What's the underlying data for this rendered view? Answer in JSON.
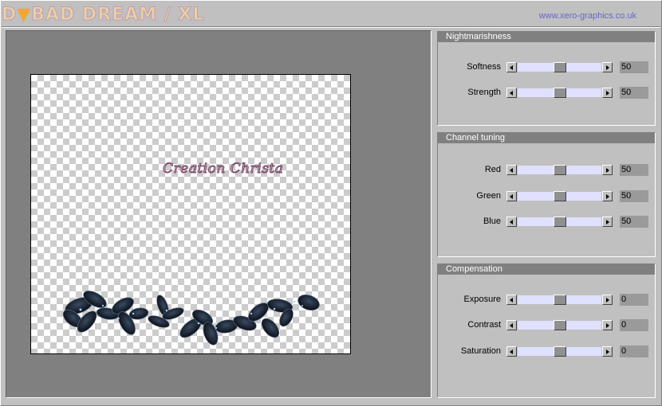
{
  "title": {
    "logo_prefix": "D",
    "logo_triangle": "▼",
    "logo_text": "BAD DREAM / XL",
    "url": "www.xero-graphics.co.uk"
  },
  "preview": {
    "signature_text": "Creation Christa"
  },
  "panels": [
    {
      "header": "Nightmarishness",
      "rows": [
        {
          "label": "Softness",
          "value": "50",
          "level": 0.5
        },
        {
          "label": "Strength",
          "value": "50",
          "level": 0.5
        }
      ]
    },
    {
      "header": "Channel tuning",
      "rows": [
        {
          "label": "Red",
          "value": "50",
          "level": 0.5
        },
        {
          "label": "Green",
          "value": "50",
          "level": 0.5
        },
        {
          "label": "Blue",
          "value": "50",
          "level": 0.5
        }
      ]
    },
    {
      "header": "Compensation",
      "rows": [
        {
          "label": "Exposure",
          "value": "0",
          "level": 0.5
        },
        {
          "label": "Contrast",
          "value": "0",
          "level": 0.5
        },
        {
          "label": "Saturation",
          "value": "0",
          "level": 0.5
        }
      ]
    }
  ],
  "colors": {
    "window_bg": "#c0c0c0",
    "preview_bg": "#808080",
    "panel_header_bg": "#808080",
    "slider_lane": "#e0e0ff",
    "url_color": "#6666cc"
  }
}
